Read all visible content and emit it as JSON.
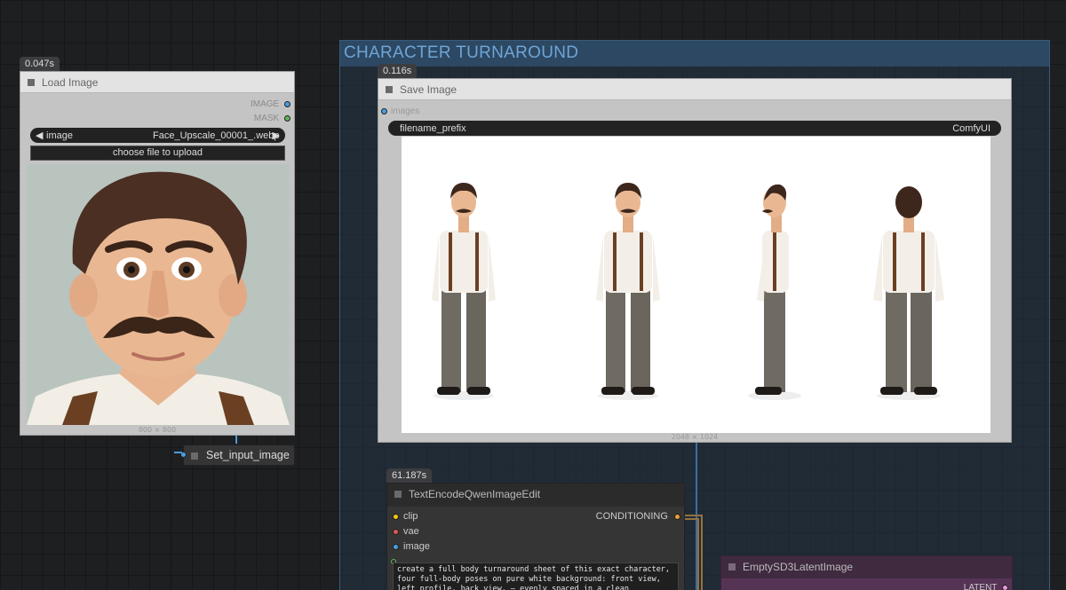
{
  "group": {
    "title": "CHARACTER TURNAROUND"
  },
  "load_image": {
    "timing": "0.047s",
    "title": "Load Image",
    "outputs": [
      "IMAGE",
      "MASK"
    ],
    "image_label": "image",
    "image_value": "Face_Upscale_00001_.webp",
    "upload_label": "choose file to upload",
    "dimensions": "800 × 800"
  },
  "set_input": {
    "title": "Set_input_image"
  },
  "save_image": {
    "timing": "0.116s",
    "title": "Save Image",
    "input_label": "images",
    "prefix_label": "filename_prefix",
    "prefix_value": "ComfyUI",
    "dimensions": "2048 × 1024"
  },
  "text_encode": {
    "timing": "61.187s",
    "title": "TextEncodeQwenImageEdit",
    "inputs": [
      "clip",
      "vae",
      "image"
    ],
    "output": "CONDITIONING",
    "prompt": "create a full body turnaround sheet of this exact character, four full-body poses on pure white background: front view, left profile, back view, — evenly spaced in a clean horizontal row, consistent"
  },
  "empty_latent": {
    "title": "EmptySD3LatentImage",
    "output": "LATENT"
  },
  "colors": {
    "image_slot": "#4a9de0",
    "mask_slot": "#5cb85c",
    "clip_slot": "#f5c518",
    "vae_slot": "#e25555",
    "conditioning_slot": "#f0a030",
    "latent_slot": "#e89ad8",
    "group_title": "#6ea5d6"
  }
}
